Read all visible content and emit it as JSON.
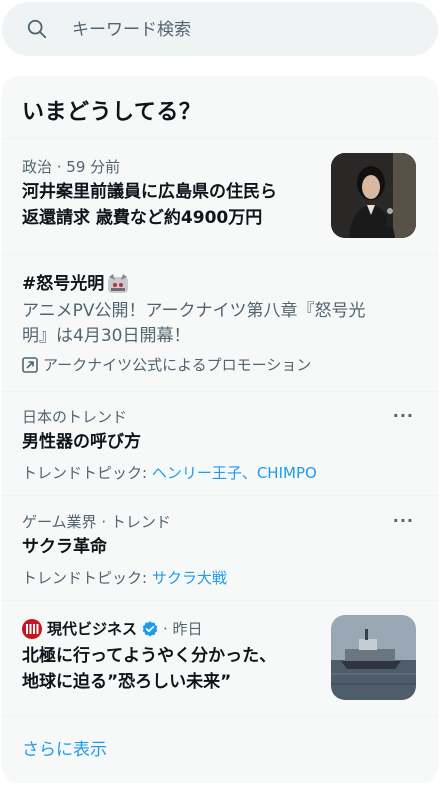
{
  "search": {
    "placeholder": "キーワード検索"
  },
  "panel": {
    "title": "いまどうしてる？"
  },
  "news1": {
    "meta": "政治 · 59 分前",
    "line1": "河井案里前議員に広島県の住民ら",
    "line2": "返還請求 歳費など約4900万円"
  },
  "promo": {
    "hashtag": "#怒号光明",
    "line1": "アニメPV公開！アークナイツ第八章『怒号光",
    "line2": "明』は4月30日開幕！",
    "promoted_by": "アークナイツ公式によるプロモーション"
  },
  "trend1": {
    "meta": "日本のトレンド",
    "title": "男性器の呼び方",
    "topic_label": "トレンドトピック: ",
    "topic_links": "ヘンリー王子、CHIMPO",
    "more": "···"
  },
  "trend2": {
    "meta": "ゲーム業界 · トレンド",
    "title": "サクラ革命",
    "topic_label": "トレンドトピック: ",
    "topic_links": "サクラ大戦",
    "more": "···"
  },
  "news2": {
    "source": "現代ビジネス",
    "time": "· 昨日",
    "line1": "北極に行ってようやく分かった、",
    "line2": "地球に迫る”恐ろしい未来”"
  },
  "show_more": "さらに表示",
  "colors": {
    "accent": "#1d9bf0",
    "secondary_text": "#536471",
    "panel_bg": "#f7f9f9",
    "verified": "#1d9bf0"
  }
}
